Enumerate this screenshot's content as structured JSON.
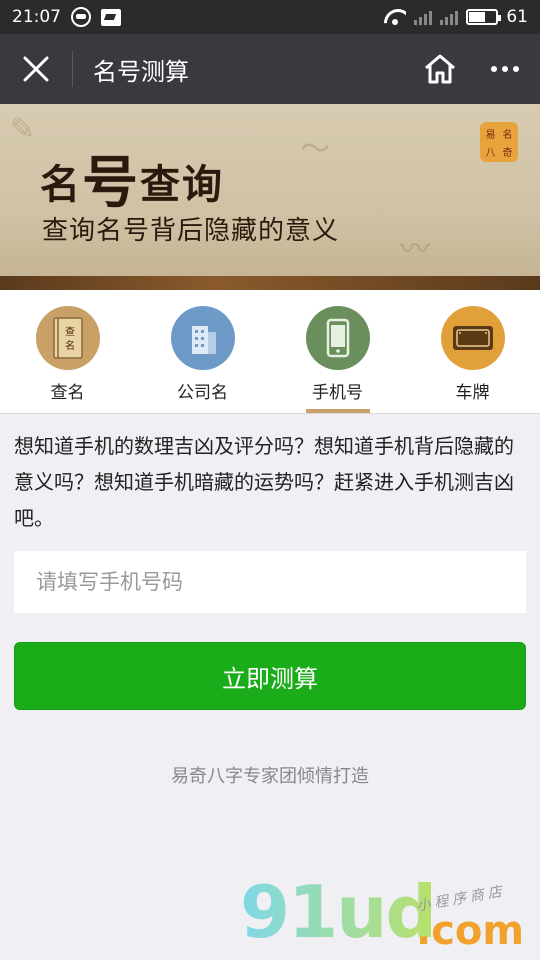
{
  "status_bar": {
    "time": "21:07",
    "battery": "61"
  },
  "nav": {
    "title": "名号测算"
  },
  "banner": {
    "title_1": "名",
    "title_2": "号",
    "title_3": "查询",
    "subtitle": "查询名号背后隐藏的意义",
    "logo_chars": [
      "易",
      "名",
      "八",
      "奇"
    ]
  },
  "tabs": [
    {
      "label": "查名",
      "icon": "name-book-icon",
      "color": "#c9a066"
    },
    {
      "label": "公司名",
      "icon": "company-building-icon",
      "color": "#6e9ac8"
    },
    {
      "label": "手机号",
      "icon": "mobile-phone-icon",
      "color": "#6a8f5c",
      "active": true
    },
    {
      "label": "车牌",
      "icon": "license-plate-icon",
      "color": "#e2a03a"
    }
  ],
  "content": {
    "description": "想知道手机的数理吉凶及评分吗？想知道手机背后隐藏的意义吗？想知道手机暗藏的运势吗？赶紧进入手机测吉凶吧。",
    "input_placeholder": "请填写手机号码",
    "submit_label": "立即测算",
    "credit": "易奇八字专家团倾情打造"
  },
  "watermark": {
    "main": "91ud",
    "suffix": ".com",
    "tag": "小程序商店"
  }
}
